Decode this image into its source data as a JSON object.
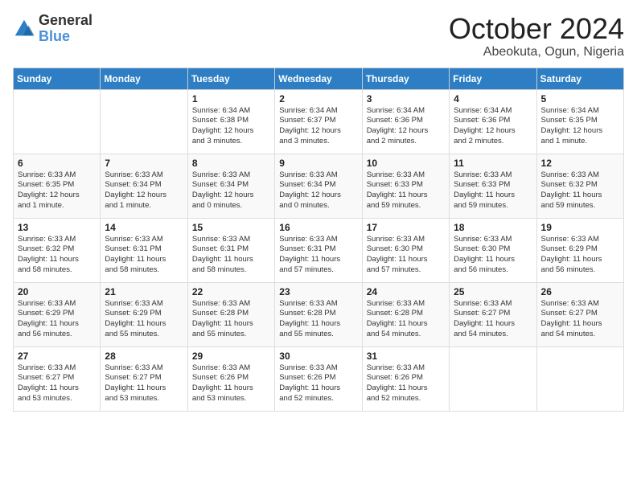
{
  "logo": {
    "general": "General",
    "blue": "Blue"
  },
  "title": "October 2024",
  "location": "Abeokuta, Ogun, Nigeria",
  "days_of_week": [
    "Sunday",
    "Monday",
    "Tuesday",
    "Wednesday",
    "Thursday",
    "Friday",
    "Saturday"
  ],
  "weeks": [
    [
      {
        "day": "",
        "info": ""
      },
      {
        "day": "",
        "info": ""
      },
      {
        "day": "1",
        "info": "Sunrise: 6:34 AM\nSunset: 6:38 PM\nDaylight: 12 hours\nand 3 minutes."
      },
      {
        "day": "2",
        "info": "Sunrise: 6:34 AM\nSunset: 6:37 PM\nDaylight: 12 hours\nand 3 minutes."
      },
      {
        "day": "3",
        "info": "Sunrise: 6:34 AM\nSunset: 6:36 PM\nDaylight: 12 hours\nand 2 minutes."
      },
      {
        "day": "4",
        "info": "Sunrise: 6:34 AM\nSunset: 6:36 PM\nDaylight: 12 hours\nand 2 minutes."
      },
      {
        "day": "5",
        "info": "Sunrise: 6:34 AM\nSunset: 6:35 PM\nDaylight: 12 hours\nand 1 minute."
      }
    ],
    [
      {
        "day": "6",
        "info": "Sunrise: 6:33 AM\nSunset: 6:35 PM\nDaylight: 12 hours\nand 1 minute."
      },
      {
        "day": "7",
        "info": "Sunrise: 6:33 AM\nSunset: 6:34 PM\nDaylight: 12 hours\nand 1 minute."
      },
      {
        "day": "8",
        "info": "Sunrise: 6:33 AM\nSunset: 6:34 PM\nDaylight: 12 hours\nand 0 minutes."
      },
      {
        "day": "9",
        "info": "Sunrise: 6:33 AM\nSunset: 6:34 PM\nDaylight: 12 hours\nand 0 minutes."
      },
      {
        "day": "10",
        "info": "Sunrise: 6:33 AM\nSunset: 6:33 PM\nDaylight: 11 hours\nand 59 minutes."
      },
      {
        "day": "11",
        "info": "Sunrise: 6:33 AM\nSunset: 6:33 PM\nDaylight: 11 hours\nand 59 minutes."
      },
      {
        "day": "12",
        "info": "Sunrise: 6:33 AM\nSunset: 6:32 PM\nDaylight: 11 hours\nand 59 minutes."
      }
    ],
    [
      {
        "day": "13",
        "info": "Sunrise: 6:33 AM\nSunset: 6:32 PM\nDaylight: 11 hours\nand 58 minutes."
      },
      {
        "day": "14",
        "info": "Sunrise: 6:33 AM\nSunset: 6:31 PM\nDaylight: 11 hours\nand 58 minutes."
      },
      {
        "day": "15",
        "info": "Sunrise: 6:33 AM\nSunset: 6:31 PM\nDaylight: 11 hours\nand 58 minutes."
      },
      {
        "day": "16",
        "info": "Sunrise: 6:33 AM\nSunset: 6:31 PM\nDaylight: 11 hours\nand 57 minutes."
      },
      {
        "day": "17",
        "info": "Sunrise: 6:33 AM\nSunset: 6:30 PM\nDaylight: 11 hours\nand 57 minutes."
      },
      {
        "day": "18",
        "info": "Sunrise: 6:33 AM\nSunset: 6:30 PM\nDaylight: 11 hours\nand 56 minutes."
      },
      {
        "day": "19",
        "info": "Sunrise: 6:33 AM\nSunset: 6:29 PM\nDaylight: 11 hours\nand 56 minutes."
      }
    ],
    [
      {
        "day": "20",
        "info": "Sunrise: 6:33 AM\nSunset: 6:29 PM\nDaylight: 11 hours\nand 56 minutes."
      },
      {
        "day": "21",
        "info": "Sunrise: 6:33 AM\nSunset: 6:29 PM\nDaylight: 11 hours\nand 55 minutes."
      },
      {
        "day": "22",
        "info": "Sunrise: 6:33 AM\nSunset: 6:28 PM\nDaylight: 11 hours\nand 55 minutes."
      },
      {
        "day": "23",
        "info": "Sunrise: 6:33 AM\nSunset: 6:28 PM\nDaylight: 11 hours\nand 55 minutes."
      },
      {
        "day": "24",
        "info": "Sunrise: 6:33 AM\nSunset: 6:28 PM\nDaylight: 11 hours\nand 54 minutes."
      },
      {
        "day": "25",
        "info": "Sunrise: 6:33 AM\nSunset: 6:27 PM\nDaylight: 11 hours\nand 54 minutes."
      },
      {
        "day": "26",
        "info": "Sunrise: 6:33 AM\nSunset: 6:27 PM\nDaylight: 11 hours\nand 54 minutes."
      }
    ],
    [
      {
        "day": "27",
        "info": "Sunrise: 6:33 AM\nSunset: 6:27 PM\nDaylight: 11 hours\nand 53 minutes."
      },
      {
        "day": "28",
        "info": "Sunrise: 6:33 AM\nSunset: 6:27 PM\nDaylight: 11 hours\nand 53 minutes."
      },
      {
        "day": "29",
        "info": "Sunrise: 6:33 AM\nSunset: 6:26 PM\nDaylight: 11 hours\nand 53 minutes."
      },
      {
        "day": "30",
        "info": "Sunrise: 6:33 AM\nSunset: 6:26 PM\nDaylight: 11 hours\nand 52 minutes."
      },
      {
        "day": "31",
        "info": "Sunrise: 6:33 AM\nSunset: 6:26 PM\nDaylight: 11 hours\nand 52 minutes."
      },
      {
        "day": "",
        "info": ""
      },
      {
        "day": "",
        "info": ""
      }
    ]
  ]
}
